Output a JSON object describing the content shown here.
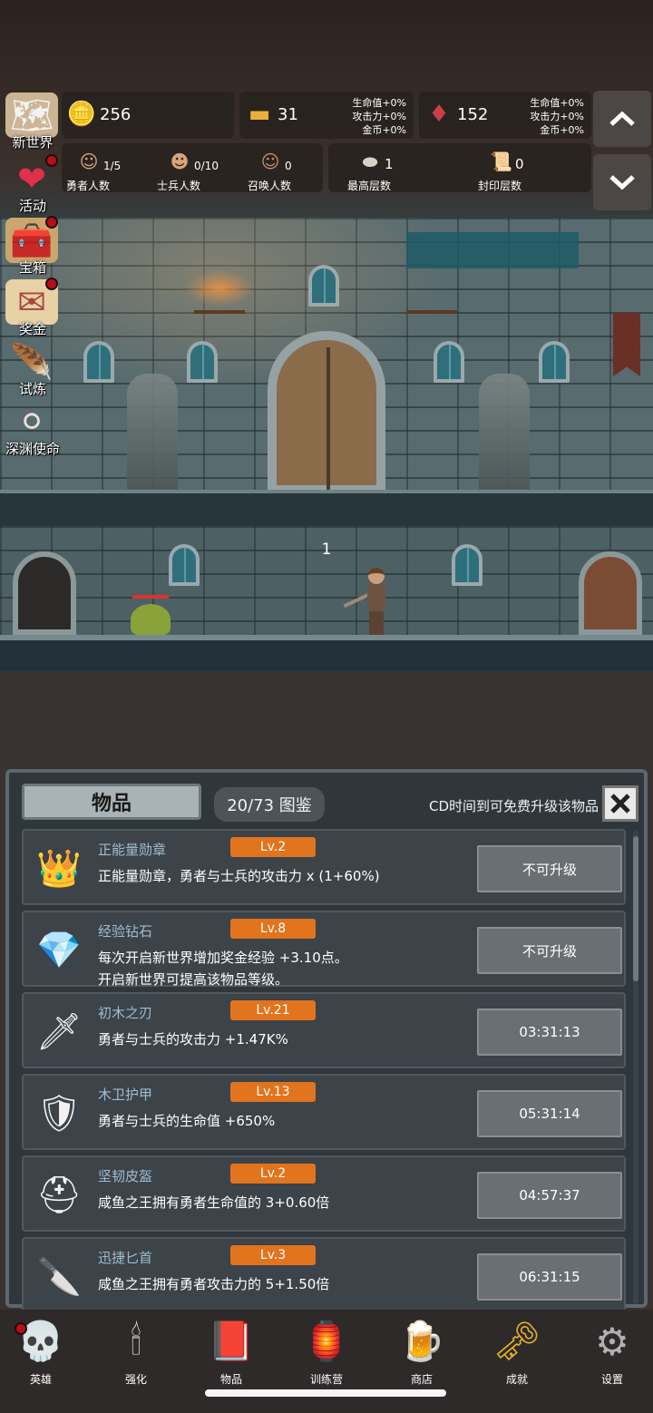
{
  "side_menu": [
    {
      "label": "新世界",
      "icon": "map-scroll-icon",
      "glyph": "🗺",
      "dot": false
    },
    {
      "label": "活动",
      "icon": "heart-icon",
      "glyph": "❤",
      "dot": true
    },
    {
      "label": "宝箱",
      "icon": "treasure-chest-icon",
      "glyph": "🧰",
      "dot": true
    },
    {
      "label": "奖金",
      "icon": "envelope-icon",
      "glyph": "✉",
      "dot": true
    },
    {
      "label": "试炼",
      "icon": "feather-icon",
      "glyph": "🪶",
      "dot": false
    },
    {
      "label": "深渊使命",
      "icon": "pearl-orb-icon",
      "glyph": "⚪",
      "dot": false
    }
  ],
  "resources": {
    "gold": {
      "value": "256",
      "icon": "gold-coin-icon",
      "glyph": "🪙"
    },
    "bar": {
      "value": "31",
      "icon": "gold-bar-icon",
      "glyph": "▬",
      "bonus": [
        "生命值+0%",
        "攻击力+0%",
        "金币+0%"
      ]
    },
    "gem": {
      "value": "152",
      "icon": "red-gem-icon",
      "glyph": "♦",
      "bonus": [
        "生命值+0%",
        "攻击力+0%",
        "金币+0%"
      ]
    }
  },
  "counts": {
    "heroes": {
      "value": "1/5",
      "label": "勇者人数",
      "icon": "hero-head-icon",
      "glyph": "☺"
    },
    "soldiers": {
      "value": "0/10",
      "label": "士兵人数",
      "icon": "soldier-head-icon",
      "glyph": "☻"
    },
    "summons": {
      "value": "0",
      "label": "召唤人数",
      "icon": "summon-head-icon",
      "glyph": "☺"
    },
    "max_floor": {
      "value": "1",
      "label": "最高层数",
      "icon": "stone-icon",
      "glyph": "⬬"
    },
    "sealed_floor": {
      "value": "0",
      "label": "封印层数",
      "icon": "scroll-icon",
      "glyph": "📜"
    }
  },
  "scene": {
    "wave": "1"
  },
  "panel": {
    "title": "物品",
    "collection": "20/73 图鉴",
    "cd_hint": "CD时间到可免费升级该物品"
  },
  "items": [
    {
      "name": "正能量勋章",
      "level": "Lv.2",
      "desc": [
        "正能量勋章，勇者与士兵的攻击力 x (1+60%)"
      ],
      "button": "不可升级",
      "icon": "crown-medal-icon",
      "glyph": "👑"
    },
    {
      "name": "经验钻石",
      "level": "Lv.8",
      "desc": [
        "每次开启新世界增加奖金经验 +3.10点。",
        "开启新世界可提高该物品等级。"
      ],
      "button": "不可升级",
      "icon": "diamond-icon",
      "glyph": "💎"
    },
    {
      "name": "初木之刃",
      "level": "Lv.21",
      "desc": [
        "勇者与士兵的攻击力 +1.47K%"
      ],
      "button": "03:31:13",
      "icon": "wooden-sword-icon",
      "glyph": "🗡"
    },
    {
      "name": "木卫护甲",
      "level": "Lv.13",
      "desc": [
        "勇者与士兵的生命值 +650%"
      ],
      "button": "05:31:14",
      "icon": "armor-icon",
      "glyph": "🛡"
    },
    {
      "name": "坚韧皮盔",
      "level": "Lv.2",
      "desc": [
        "咸鱼之王拥有勇者生命值的 3+0.60倍"
      ],
      "button": "04:57:37",
      "icon": "leather-helmet-icon",
      "glyph": "⛑"
    },
    {
      "name": "迅捷匕首",
      "level": "Lv.3",
      "desc": [
        "咸鱼之王拥有勇者攻击力的 5+1.50倍"
      ],
      "button": "06:31:15",
      "icon": "dagger-icon",
      "glyph": "🔪"
    }
  ],
  "bottom_nav": [
    {
      "label": "英雄",
      "icon": "skull-icon",
      "glyph": "💀",
      "dot": true
    },
    {
      "label": "强化",
      "icon": "candle-icon",
      "glyph": "🕯",
      "dot": false
    },
    {
      "label": "物品",
      "icon": "book-icon",
      "glyph": "📕",
      "dot": false
    },
    {
      "label": "训练营",
      "icon": "lantern-icon",
      "glyph": "🏮",
      "dot": false
    },
    {
      "label": "商店",
      "icon": "beer-mug-icon",
      "glyph": "🍺",
      "dot": false
    },
    {
      "label": "成就",
      "icon": "key-icon",
      "glyph": "🗝",
      "dot": false
    },
    {
      "label": "设置",
      "icon": "gear-icon",
      "glyph": "⚙",
      "dot": false
    }
  ]
}
